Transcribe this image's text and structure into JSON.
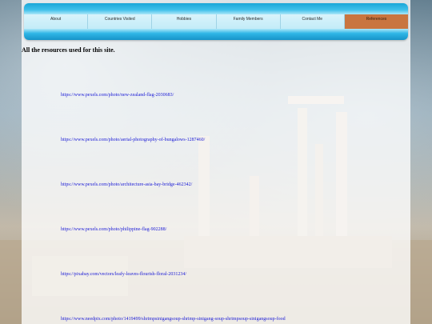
{
  "nav": {
    "items": [
      {
        "label": "About"
      },
      {
        "label": "Countries Visited"
      },
      {
        "label": "Hobbies"
      },
      {
        "label": "Family Members"
      },
      {
        "label": "Contact Me"
      },
      {
        "label": "References"
      }
    ],
    "active_index": 5,
    "active_color": "#c9753f",
    "bar_color": "#1aa7d8"
  },
  "main": {
    "heading": "All the resources used for this site.",
    "links": [
      "https://www.pexels.com/photo/new-zealand-flag-2030683/",
      "https://www.pexels.com/photo/aerial-photography-of-bungalows-1287460/",
      "https://www.pexels.com/photo/architecture-asia-bay-bridge-462342/",
      "https://www.pexels.com/photo/philippine-flag-902288/",
      "https://pixabay.com/vectors/leafy-leaves-flourish-floral-2031234/",
      "https://www.needpix.com/photo/1419499/shrimpsinigangsoup-shrimp-sinigang-soup-shrimpsoup-sinigangsoup-food"
    ],
    "link_color": "#1a1ad6"
  }
}
